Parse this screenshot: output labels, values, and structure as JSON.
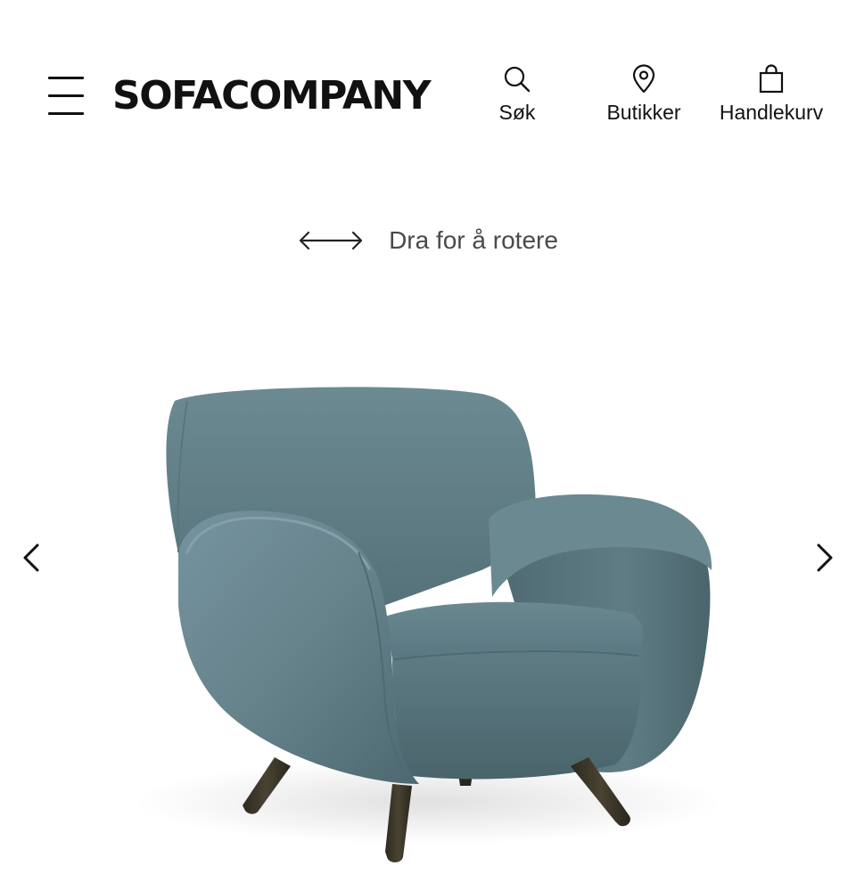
{
  "header": {
    "brand": "SOFACOMPANY",
    "menu_icon": "hamburger-menu-icon",
    "nav": {
      "search": {
        "label": "Søk",
        "icon": "search-icon"
      },
      "stores": {
        "label": "Butikker",
        "icon": "map-pin-icon"
      },
      "cart": {
        "label": "Handlekurv",
        "icon": "shopping-bag-icon"
      }
    }
  },
  "viewer": {
    "rotate_hint": "Dra for å rotere",
    "rotate_icon": "horizontal-arrows-icon",
    "product_image": "teal-armchair",
    "prev_icon": "chevron-left-icon",
    "next_icon": "chevron-right-icon"
  },
  "colors": {
    "text": "#111111",
    "hint_text": "#4a4a4a",
    "upholstery": "#5e7b82",
    "legs": "#3b3528",
    "background": "#ffffff"
  }
}
